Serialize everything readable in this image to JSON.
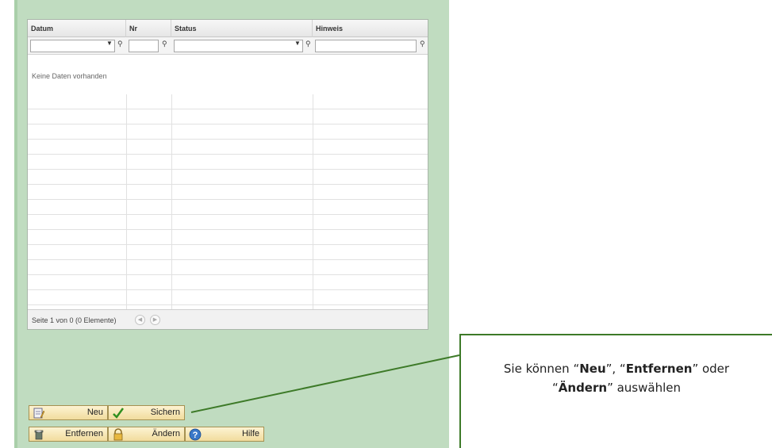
{
  "grid": {
    "columns": [
      "Datum",
      "Nr",
      "Status",
      "Hinweis"
    ],
    "empty_message": "Keine Daten vorhanden",
    "pager_text": "Seite 1 von 0 (0 Elemente)"
  },
  "buttons": {
    "neu": "Neu",
    "sichern": "Sichern",
    "entfernen": "Entfernen",
    "aendern": "Ändern",
    "hilfe": "Hilfe"
  },
  "callout": {
    "pre": "Sie können “",
    "neu": "Neu",
    "sep1": "”, “",
    "entfernen": "Entfernen",
    "sep2": "” oder “",
    "aendern": "Ändern",
    "post": "” auswählen"
  },
  "colors": {
    "panel": "#c0dcc0",
    "callout_border": "#3d7a28",
    "button_face": "#f1dc9d"
  }
}
